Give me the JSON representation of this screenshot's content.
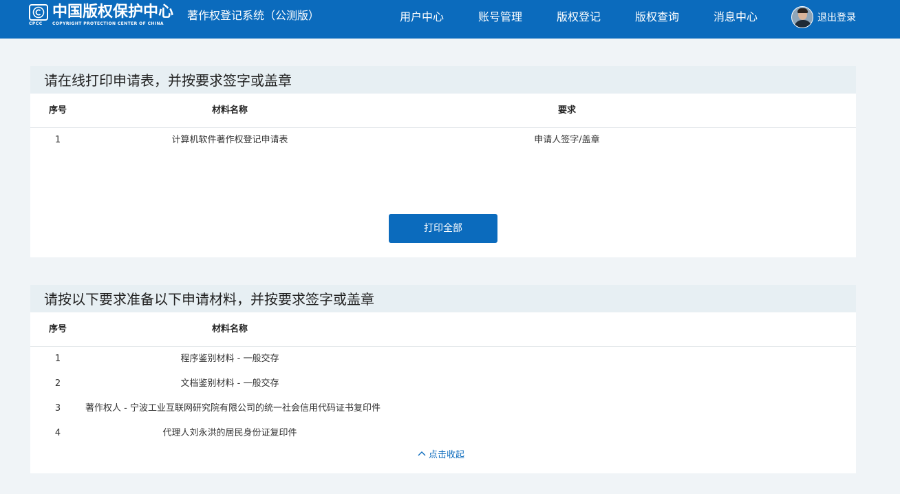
{
  "header": {
    "logo_title": "中国版权保护中心",
    "logo_abbr": "CPCC",
    "logo_subtitle": "COPYRIGHT PROTECTION CENTER OF CHINA",
    "system_name": "著作权登记系统（公测版）",
    "nav": [
      "用户中心",
      "账号管理",
      "版权登记",
      "版权查询",
      "消息中心"
    ],
    "logout_label": "退出登录",
    "colors": {
      "brand": "#0b6bbd",
      "text": "#ffffff"
    }
  },
  "print_section": {
    "title": "请在线打印申请表，并按要求签字或盖章",
    "columns": {
      "no": "序号",
      "name": "材料名称",
      "requirement": "要求"
    },
    "rows": [
      {
        "no": "1",
        "name": "计算机软件著作权登记申请表",
        "requirement": "申请人签字/盖章"
      }
    ],
    "print_all_label": "打印全部"
  },
  "materials_section": {
    "title": "请按以下要求准备以下申请材料，并按要求签字或盖章",
    "columns": {
      "no": "序号",
      "name": "材料名称"
    },
    "rows": [
      {
        "no": "1",
        "name": "程序鉴别材料 - 一般交存"
      },
      {
        "no": "2",
        "name": "文档鉴别材料 - 一般交存"
      },
      {
        "no": "3",
        "name": "著作权人 - 宁波工业互联网研究院有限公司的统一社会信用代码证书复印件"
      },
      {
        "no": "4",
        "name": "代理人刘永洪的居民身份证复印件"
      }
    ],
    "collapse_label": "点击收起",
    "collapse_icon": "chevron-up-icon"
  },
  "icons": [
    "copyright-logo-icon",
    "avatar"
  ]
}
